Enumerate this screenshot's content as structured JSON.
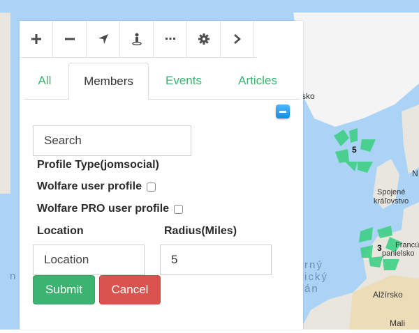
{
  "toolbar": {
    "buttons": [
      {
        "icon": "zoom-in-icon"
      },
      {
        "icon": "zoom-out-icon"
      },
      {
        "icon": "locate-icon"
      },
      {
        "icon": "street-view-icon"
      },
      {
        "icon": "more-icon"
      },
      {
        "icon": "gear-icon"
      },
      {
        "icon": "chevron-right-icon"
      }
    ]
  },
  "tabs": [
    {
      "label": "All",
      "active": false
    },
    {
      "label": "Members",
      "active": true
    },
    {
      "label": "Events",
      "active": false
    },
    {
      "label": "Articles",
      "active": false
    }
  ],
  "form": {
    "search_placeholder": "Search",
    "profile_type_label": "Profile Type(jomsocial)",
    "option_user_profile": "Wolfare user profile",
    "option_pro_profile": "Wolfare PRO user profile",
    "location_label": "Location",
    "radius_label": "Radius(Miles)",
    "location_placeholder": "Location",
    "radius_value": "5",
    "submit_label": "Submit",
    "cancel_label": "Cancel"
  },
  "map": {
    "labels": {
      "sko": "sko",
      "spojene": "Spojené",
      "kralovstvo": "kráľovstvo",
      "francuzsko": "Francúzs",
      "spanielsko": "panielsko",
      "alzirsko": "Alžírsko",
      "mali": "Mali",
      "sea_1": "rný",
      "sea_2": "ický",
      "sea_3": "án",
      "edge_n": "n",
      "edge_n2": "N"
    },
    "cluster_counts": [
      "5",
      "3"
    ],
    "colors": {
      "water": "#aad3f5",
      "land": "#e8e6df",
      "greenland": "#f4f4f4",
      "cluster": "#3ecf85"
    }
  }
}
